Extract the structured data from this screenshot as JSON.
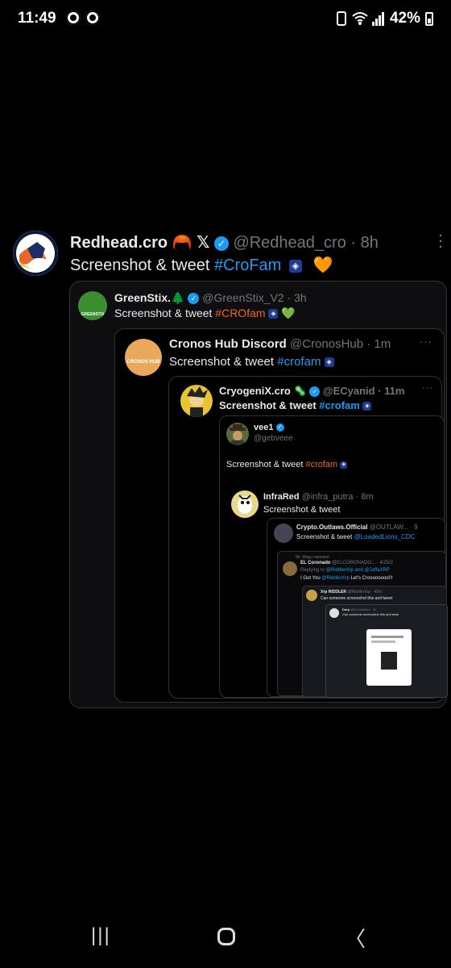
{
  "status": {
    "time": "11:49",
    "battery": "42%"
  },
  "tweet": {
    "name": "Redhead.cro",
    "emoji": "🦰",
    "x_glyph": "𝕏",
    "handle": "@Redhead_cro",
    "time": "· 8h",
    "text": "Screenshot & tweet ",
    "hashtag": "#CroFam",
    "heart": "🧡",
    "more": "⋮"
  },
  "q1": {
    "avatar_text": "GREENSTIX",
    "name": "GreenStix.🌲",
    "handle": "@GreenStix_V2 · 3h",
    "text": "Screenshot & tweet ",
    "hashtag": "#CROfam",
    "heart": "💚"
  },
  "q2": {
    "avatar_text": "CRONOS HUB",
    "name": "Cronos Hub Discord",
    "handle": "@CronosHub · 1m",
    "text": "Screenshot & tweet ",
    "hashtag": "#crofam",
    "more": "···"
  },
  "q3": {
    "name": "CryogeniX.cro",
    "emoji": "🦠",
    "handle": "@ECyanid · 11m",
    "text": "Screenshot & tweet ",
    "hashtag": "#crofam",
    "more": "···"
  },
  "q4": {
    "name": "vee1",
    "handle": "@gebveee",
    "text": "Screenshot & tweet ",
    "hashtag": "#crofam"
  },
  "q5": {
    "name": "InfraRed",
    "handle": "@infra_putra · 8m",
    "text": "Screenshot & tweet"
  },
  "q6": {
    "name": "Crypto.Outlaws.Official",
    "handle": "@OUTLAW... · 9",
    "text": "Screenshot & tweet ",
    "mention": "@LoadedLions_CDC"
  },
  "q7": {
    "reposted": "Mr. Magu reposted",
    "name": "EL Coronado",
    "handle": "@ELCORONADO... · 4/25/2",
    "reply_prefix": "Replying to ",
    "reply_mentions": "@RiddlerXrp and @JaffaXRP",
    "text_prefix": "I Got You ",
    "text_mention": "@RiddlerXrp",
    "text_suffix": " Let's Croooooooo!!!"
  },
  "q8": {
    "name": "Xrp RIDDLER",
    "handle": "@RiddlerXrp · 40m",
    "text": "Can someone screenshot this and tweet"
  },
  "q9": {
    "name": "Dory",
    "handle": "@DoryNaked · 4h",
    "text": "Can someone screenshot this and twee"
  },
  "nav": {
    "recents": "|||",
    "home": "◯",
    "back": "〈"
  }
}
